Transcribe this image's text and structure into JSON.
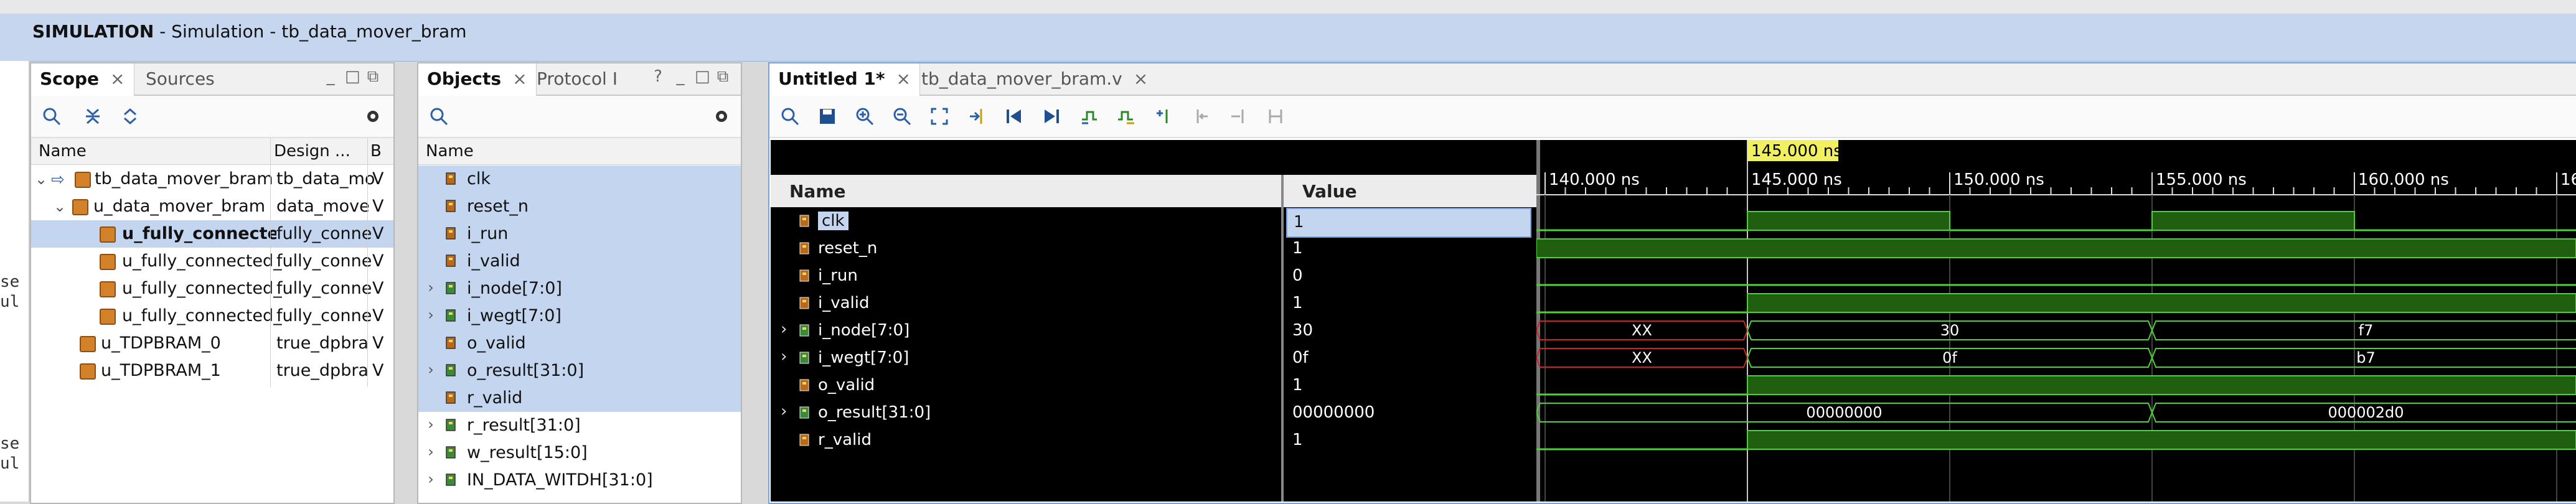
{
  "banner": {
    "title": "SIMULATION",
    "subtitle": " - Simulation - tb_data_mover_bram"
  },
  "left_edge_fragments": [
    "se",
    "ul",
    "se",
    "ul"
  ],
  "scope": {
    "tabs": [
      {
        "label": "Scope"
      },
      {
        "label": "Sources"
      }
    ],
    "columns": [
      "Name",
      "Design ...",
      "B"
    ],
    "rows": [
      {
        "name": "tb_data_mover_bram",
        "design": "tb_data_mo",
        "b": "V"
      },
      {
        "name": "u_data_mover_bram",
        "design": "data_move",
        "b": "V"
      },
      {
        "name": "u_fully_connecte",
        "design": "fully_conne",
        "b": "V"
      },
      {
        "name": "u_fully_connected_",
        "design": "fully_conne",
        "b": "V"
      },
      {
        "name": "u_fully_connected_",
        "design": "fully_conne",
        "b": "V"
      },
      {
        "name": "u_fully_connected_",
        "design": "fully_conne",
        "b": "V"
      },
      {
        "name": "u_TDPBRAM_0",
        "design": "true_dpbra",
        "b": "V"
      },
      {
        "name": "u_TDPBRAM_1",
        "design": "true_dpbra",
        "b": "V"
      }
    ]
  },
  "objects": {
    "tabs": [
      {
        "label": "Objects"
      },
      {
        "label": "Protocol I"
      }
    ],
    "column": "Name",
    "rows": [
      {
        "name": "clk"
      },
      {
        "name": "reset_n"
      },
      {
        "name": "i_run"
      },
      {
        "name": "i_valid"
      },
      {
        "name": "i_node[7:0]"
      },
      {
        "name": "i_wegt[7:0]"
      },
      {
        "name": "o_valid"
      },
      {
        "name": "o_result[31:0]"
      },
      {
        "name": "r_valid"
      },
      {
        "name": "r_result[31:0]"
      },
      {
        "name": "w_result[15:0]"
      },
      {
        "name": "IN_DATA_WITDH[31:0]"
      }
    ]
  },
  "wave": {
    "tabs": [
      {
        "label": "Untitled 1*"
      },
      {
        "label": "tb_data_mover_bram.v"
      }
    ],
    "name_header": "Name",
    "value_header": "Value",
    "cursor_label": "145.000 ns",
    "time_labels": [
      "140.000 ns",
      "145.000 ns",
      "150.000 ns",
      "155.000 ns",
      "160.000 ns",
      "16"
    ],
    "signals": [
      {
        "name": "clk",
        "value": "1"
      },
      {
        "name": "reset_n",
        "value": "1"
      },
      {
        "name": "i_run",
        "value": "0"
      },
      {
        "name": "i_valid",
        "value": "1"
      },
      {
        "name": "i_node[7:0]",
        "value": "30"
      },
      {
        "name": "i_wegt[7:0]",
        "value": "0f"
      },
      {
        "name": "o_valid",
        "value": "1"
      },
      {
        "name": "o_result[31:0]",
        "value": "00000000"
      },
      {
        "name": "r_valid",
        "value": "1"
      }
    ],
    "bus_labels": {
      "i_node": [
        "XX",
        "30",
        "f7"
      ],
      "i_wegt": [
        "XX",
        "0f",
        "b7"
      ],
      "o_result": [
        "00000000",
        "000002d0"
      ]
    }
  },
  "colors": {
    "wave_green": "#1f5f0f",
    "wave_line": "#4fd03a",
    "xx_red": "#d02020",
    "cursor": "#f0f060",
    "selection": "#c4d5ef"
  }
}
